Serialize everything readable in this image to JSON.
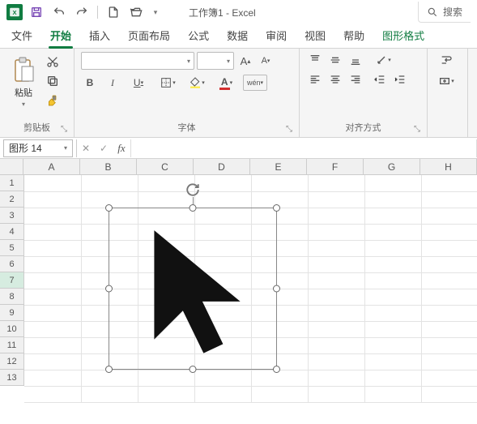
{
  "titlebar": {
    "title": "工作簿1 - Excel"
  },
  "search": {
    "placeholder": "搜索"
  },
  "tabs": {
    "file": "文件",
    "home": "开始",
    "insert": "插入",
    "layout": "页面布局",
    "formulas": "公式",
    "data": "数据",
    "review": "审阅",
    "view": "视图",
    "help": "帮助",
    "shapefmt": "图形格式"
  },
  "ribbon": {
    "clipboard": {
      "paste": "粘贴",
      "group": "剪贴板"
    },
    "font": {
      "group": "字体",
      "bold": "B",
      "italic": "I",
      "underline": "U",
      "wen": "wén"
    },
    "align": {
      "group": "对齐方式"
    }
  },
  "namebox": {
    "value": "图形 14"
  },
  "grid": {
    "cols": [
      "A",
      "B",
      "C",
      "D",
      "E",
      "F",
      "G",
      "H"
    ],
    "rows": [
      "1",
      "2",
      "3",
      "4",
      "5",
      "6",
      "7",
      "8",
      "9",
      "10",
      "11",
      "12",
      "13"
    ],
    "selectedRow": "7"
  }
}
